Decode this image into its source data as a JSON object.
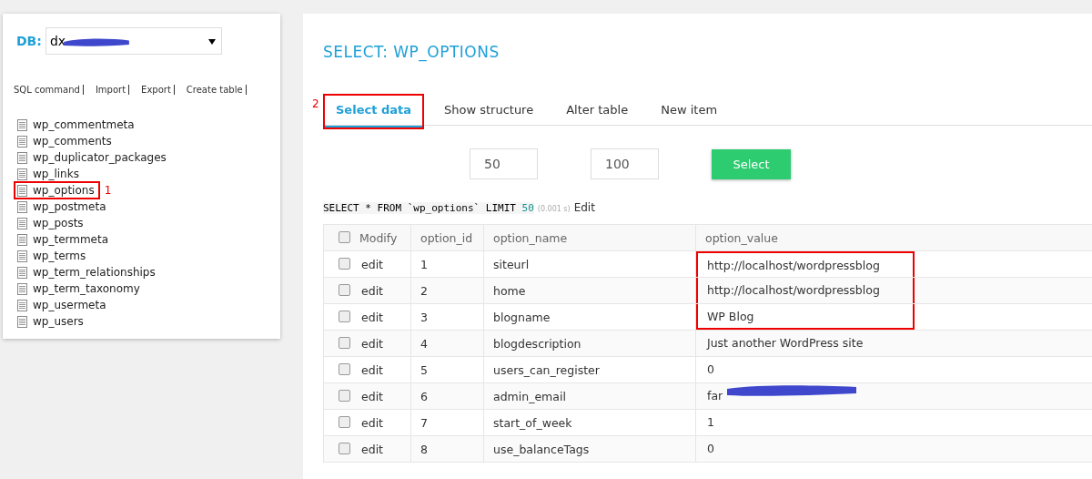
{
  "db": {
    "label": "DB:",
    "value": "dx",
    "redacted": true
  },
  "links": [
    "SQL command",
    "Import",
    "Export",
    "Create table"
  ],
  "tables": [
    {
      "name": "wp_commentmeta",
      "highlighted": false
    },
    {
      "name": "wp_comments",
      "highlighted": false
    },
    {
      "name": "wp_duplicator_packages",
      "highlighted": false
    },
    {
      "name": "wp_links",
      "highlighted": false
    },
    {
      "name": "wp_options",
      "highlighted": true,
      "callout": "1"
    },
    {
      "name": "wp_postmeta",
      "highlighted": false
    },
    {
      "name": "wp_posts",
      "highlighted": false
    },
    {
      "name": "wp_termmeta",
      "highlighted": false
    },
    {
      "name": "wp_terms",
      "highlighted": false
    },
    {
      "name": "wp_term_relationships",
      "highlighted": false
    },
    {
      "name": "wp_term_taxonomy",
      "highlighted": false
    },
    {
      "name": "wp_usermeta",
      "highlighted": false
    },
    {
      "name": "wp_users",
      "highlighted": false
    }
  ],
  "title": "SELECT: WP_OPTIONS",
  "tabs": [
    {
      "label": "Select data",
      "selected": true,
      "highlighted": true,
      "callout": "2"
    },
    {
      "label": "Show structure",
      "selected": false,
      "highlighted": false
    },
    {
      "label": "Alter table",
      "selected": false,
      "highlighted": false
    },
    {
      "label": "New item",
      "selected": false,
      "highlighted": false
    }
  ],
  "limit": {
    "value": "50"
  },
  "text_length": {
    "value": "100"
  },
  "select_button": "Select",
  "query": {
    "sql": "SELECT * FROM `wp_options` LIMIT ",
    "limit": "50",
    "time": "(0.001 s)",
    "edit": "Edit"
  },
  "table": {
    "header_checked": false,
    "columns": [
      "Modify",
      "option_id",
      "option_name",
      "option_value"
    ],
    "rows": [
      {
        "checked": false,
        "edit": "edit",
        "id": "1",
        "name": "siteurl",
        "value": "http://localhost/wordpressblog",
        "highlighted": true,
        "redacted": false
      },
      {
        "checked": false,
        "edit": "edit",
        "id": "2",
        "name": "home",
        "value": "http://localhost/wordpressblog",
        "highlighted": true,
        "redacted": false
      },
      {
        "checked": false,
        "edit": "edit",
        "id": "3",
        "name": "blogname",
        "value": "WP Blog",
        "highlighted": true,
        "redacted": false
      },
      {
        "checked": false,
        "edit": "edit",
        "id": "4",
        "name": "blogdescription",
        "value": "Just another WordPress site",
        "highlighted": false,
        "redacted": false
      },
      {
        "checked": false,
        "edit": "edit",
        "id": "5",
        "name": "users_can_register",
        "value": "0",
        "highlighted": false,
        "redacted": false
      },
      {
        "checked": false,
        "edit": "edit",
        "id": "6",
        "name": "admin_email",
        "value": "far",
        "highlighted": false,
        "redacted": true
      },
      {
        "checked": false,
        "edit": "edit",
        "id": "7",
        "name": "start_of_week",
        "value": "1",
        "highlighted": false,
        "redacted": false
      },
      {
        "checked": false,
        "edit": "edit",
        "id": "8",
        "name": "use_balanceTags",
        "value": "0",
        "highlighted": false,
        "redacted": false
      }
    ]
  }
}
